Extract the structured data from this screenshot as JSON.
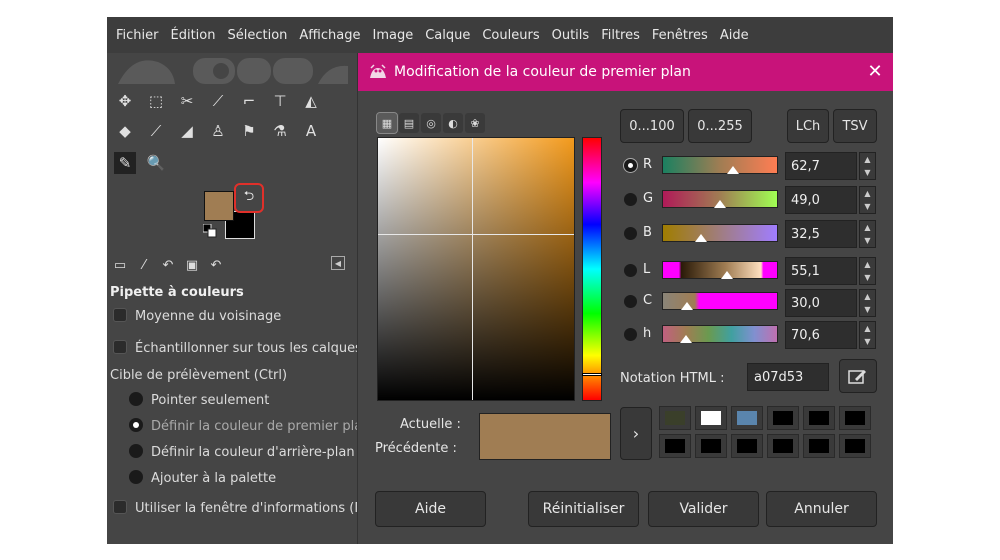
{
  "menubar": {
    "items": [
      "Fichier",
      "Édition",
      "Sélection",
      "Affichage",
      "Image",
      "Calque",
      "Couleurs",
      "Outils",
      "Filtres",
      "Fenêtres",
      "Aide"
    ]
  },
  "toolbox": {
    "tools": [
      [
        "move-tool-icon",
        "✥"
      ],
      [
        "rect-select-icon",
        "⬚"
      ],
      [
        "transform-icon",
        "✂"
      ],
      [
        "path-icon",
        "⟋"
      ],
      [
        "crop-icon",
        "⌐"
      ],
      [
        "warp-icon",
        "⊤"
      ],
      [
        "clone-icon",
        "◭"
      ],
      [
        "bucket-fill-icon",
        "◆"
      ],
      [
        "paintbrush-icon",
        "⟋"
      ],
      [
        "eraser-icon",
        "◢"
      ],
      [
        "heal-icon",
        "♙"
      ],
      [
        "smudge-icon",
        "⚑"
      ],
      [
        "gegl-icon",
        "⚗"
      ],
      [
        "text-tool-icon",
        "A"
      ],
      [
        "color-picker-icon",
        "✎"
      ],
      [
        "zoom-icon",
        "🔍"
      ]
    ],
    "foreground_color": "#a07d53",
    "background_color": "#000000"
  },
  "tool_options": {
    "title": "Pipette à couleurs",
    "sample_average": "Moyenne du voisinage",
    "sample_merged": "Échantillonner sur tous les calques",
    "target_label": "Cible de prélèvement (Ctrl)",
    "target_options": [
      {
        "label": "Pointer seulement",
        "checked": false
      },
      {
        "label": "Définir la couleur de premier pla",
        "checked": true
      },
      {
        "label": "Définir la couleur d'arrière-plan",
        "checked": false
      },
      {
        "label": "Ajouter à la palette",
        "checked": false
      }
    ],
    "info_window": "Utiliser la fenêtre d'informations (M"
  },
  "dialog": {
    "title": "Modification de la couleur de premier plan",
    "close_glyph": "✕",
    "scale_buttons": [
      "0...100",
      "0...255"
    ],
    "model_buttons": [
      "LCh",
      "TSV"
    ],
    "channels": [
      {
        "name": "R",
        "value": "62,7",
        "checked": true
      },
      {
        "name": "G",
        "value": "49,0",
        "checked": false
      },
      {
        "name": "B",
        "value": "32,5",
        "checked": false
      },
      {
        "name": "L",
        "value": "55,1",
        "checked": false
      },
      {
        "name": "C",
        "value": "30,0",
        "checked": false
      },
      {
        "name": "h",
        "value": "70,6",
        "checked": false
      }
    ],
    "html_label": "Notation HTML :",
    "html_value": "a07d53",
    "current_label": "Actuelle :",
    "previous_label": "Précédente :",
    "current_color": "#a07d53",
    "history_colors": [
      "#3a3f2a",
      "#ffffff",
      "#5a85ad",
      "#000000",
      "#000000",
      "#000000",
      "#000000",
      "#000000",
      "#000000",
      "#000000",
      "#000000",
      "#000000"
    ],
    "buttons": {
      "help": "Aide",
      "reset": "Réinitialiser",
      "ok": "Valider",
      "cancel": "Annuler"
    }
  },
  "colors": {
    "title_bar": "#c8137a",
    "swap_highlight": "#e0302a"
  }
}
